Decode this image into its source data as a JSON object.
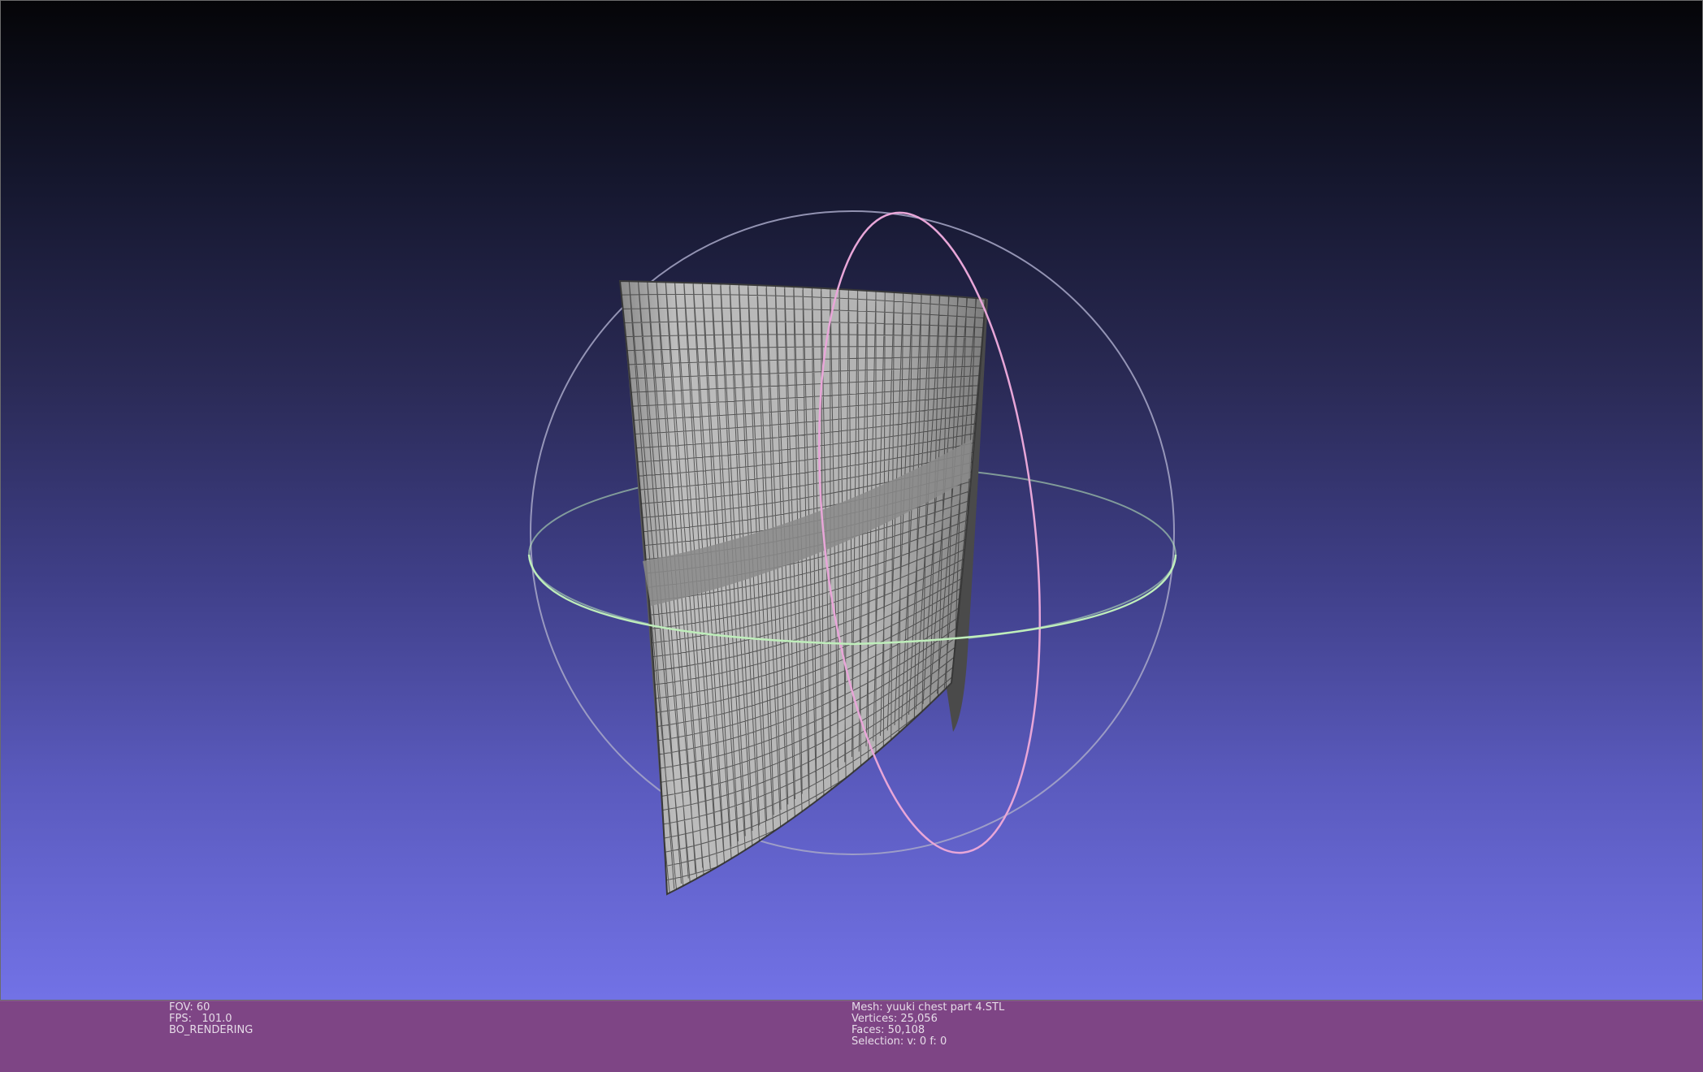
{
  "viewport": {
    "background_top": "#050508",
    "background_bottom": "#7272e6",
    "mesh_color": "#b8b8b8",
    "wire_color": "#2e2e2e",
    "trackball_x_color": "#e8a6d8",
    "trackball_y_color": "#bfeebb",
    "trackball_z_color": "#a8a8c8"
  },
  "status_bar": {
    "background": "#7e4585",
    "render_info": {
      "fov": "FOV: 60",
      "fps": "FPS:   101.0",
      "mode": "BO_RENDERING"
    },
    "mesh_info": {
      "mesh": "Mesh: yuuki chest part 4.STL",
      "vertices": "Vertices: 25,056",
      "faces": "Faces: 50,108",
      "selection": "Selection: v: 0 f: 0"
    }
  }
}
